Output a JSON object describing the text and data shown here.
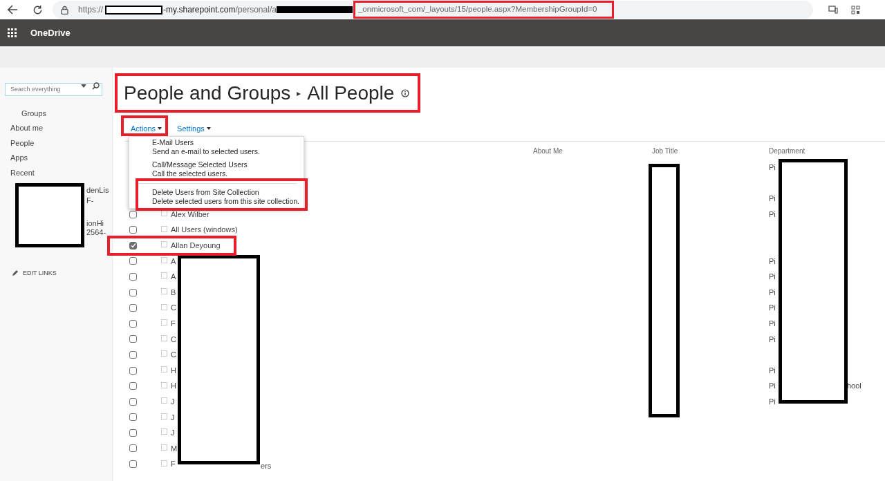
{
  "browser": {
    "scheme": "https://",
    "host": "-my.sharepoint.com",
    "path_start": "/personal/a",
    "path_end": "_onmicrosoft_com/_layouts/15/people.aspx?MembershipGroupId=0"
  },
  "suite_bar": {
    "app_name": "OneDrive"
  },
  "sidebar": {
    "search_placeholder": "Search everything",
    "items": [
      {
        "label": "Groups",
        "indented": true
      },
      {
        "label": "About me",
        "indented": false
      },
      {
        "label": "People",
        "indented": false
      },
      {
        "label": "Apps",
        "indented": false
      },
      {
        "label": "Recent",
        "indented": false
      }
    ],
    "fragments": [
      "denLis",
      "F-",
      "ionHi",
      "2564-"
    ],
    "edit_links": "EDIT LINKS"
  },
  "page_title": {
    "section": "People and Groups",
    "separator": "▸",
    "current": "All People"
  },
  "toolbar": [
    "Actions",
    "Settings"
  ],
  "actions_menu": [
    {
      "title": "E-Mail Users",
      "description": "Send an e-mail to selected users."
    },
    {
      "title": "Call/Message Selected Users",
      "description": "Call the selected users."
    },
    {
      "title": "Delete Users from Site Collection",
      "description": "Delete selected users from this site collection."
    }
  ],
  "table": {
    "columns": [
      "About Me",
      "Job Title",
      "Department"
    ],
    "rows": [
      {
        "department": "Pi"
      },
      {},
      {
        "department": "Pi"
      },
      {
        "selected": false,
        "name": "Alex Wilber",
        "department": "Pi"
      },
      {
        "selected": false,
        "name": "All Users (windows)"
      },
      {
        "selected": true,
        "name": "Allan Deyoung"
      },
      {
        "selected": false,
        "name": "A",
        "department": "Pi"
      },
      {
        "selected": false,
        "name": "A",
        "department": "Pi"
      },
      {
        "selected": false,
        "name": "B",
        "department": "Pi"
      },
      {
        "selected": false,
        "name": "C",
        "department": "Pi"
      },
      {
        "selected": false,
        "name": "F",
        "department": "Pi"
      },
      {
        "selected": false,
        "name": "C",
        "department": "Pi"
      },
      {
        "selected": false,
        "name": "C"
      },
      {
        "selected": false,
        "name": "H",
        "department": "Pi"
      },
      {
        "selected": false,
        "name": "H",
        "department": "Pi",
        "department_tail": "hool"
      },
      {
        "selected": false,
        "name": "J",
        "department": "Pi"
      },
      {
        "selected": false,
        "name": "J"
      },
      {
        "selected": false,
        "name": "J"
      },
      {
        "selected": false,
        "name": "M"
      },
      {
        "selected": false,
        "name": "F",
        "name_tail": "ers"
      }
    ]
  }
}
